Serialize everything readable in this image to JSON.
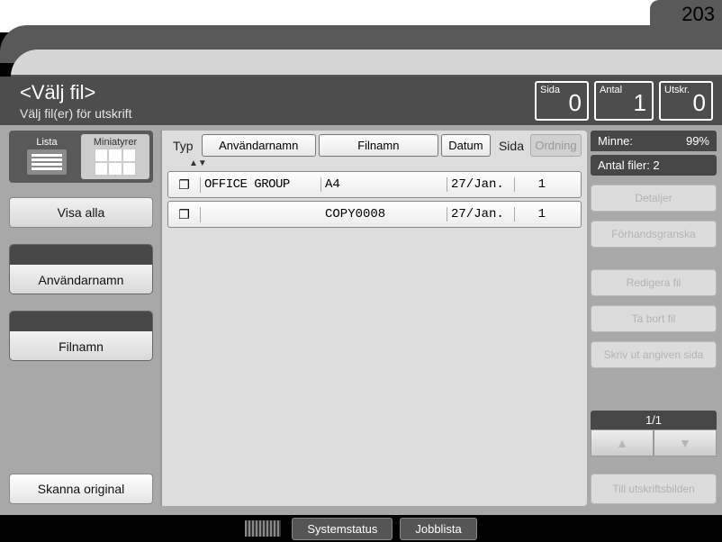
{
  "tab_number": "203",
  "header": {
    "title": "<Välj fil>",
    "subtitle": "Välj fil(er) för utskrift",
    "counters": [
      {
        "label": "Sida",
        "value": "0"
      },
      {
        "label": "Antal",
        "value": "1"
      },
      {
        "label": "Utskr.",
        "value": "0"
      }
    ]
  },
  "sidebar_left": {
    "list_label": "Lista",
    "thumb_label": "Miniatyrer",
    "show_all": "Visa alla",
    "username": "Användarnamn",
    "filename": "Filnamn",
    "scan_original": "Skanna original"
  },
  "columns": {
    "type": "Typ",
    "username": "Användarnamn",
    "filename": "Filnamn",
    "date": "Datum",
    "page": "Sida",
    "order": "Ordning"
  },
  "rows": [
    {
      "user": "OFFICE GROUP",
      "file": "A4",
      "date": "27/Jan.",
      "page": "1"
    },
    {
      "user": "",
      "file": "COPY0008",
      "date": "27/Jan.",
      "page": "1"
    }
  ],
  "sidebar_right": {
    "memory_label": "Minne:",
    "memory_value": "99%",
    "files_count": "Antal filer: 2",
    "details": "Detaljer",
    "preview": "Förhandsgranska",
    "edit": "Redigera fil",
    "delete": "Ta bort fil",
    "print_page": "Skriv ut angiven sida",
    "pager": "1/1",
    "to_print": "Till utskriftsbilden"
  },
  "footer": {
    "status": "Systemstatus",
    "joblist": "Jobblista"
  }
}
